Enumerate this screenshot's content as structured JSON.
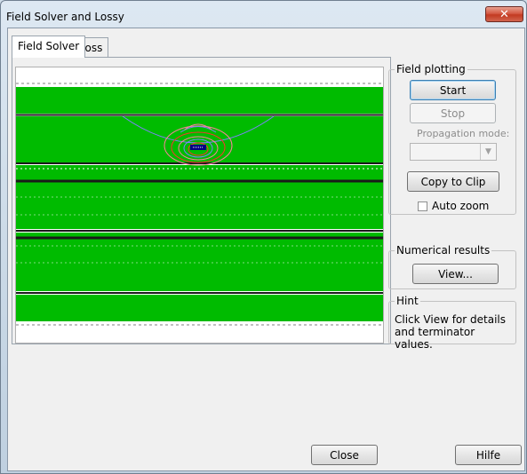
{
  "window": {
    "title": "Field Solver and Lossy",
    "close_glyph": "✕"
  },
  "tabs": [
    {
      "label": "Field Solver",
      "active": true
    },
    {
      "label": "Loss",
      "active": false
    }
  ],
  "field_plotting": {
    "label": "Field plotting",
    "start_label": "Start",
    "stop_label": "Stop",
    "propagation_mode_label": "Propagation mode:",
    "propagation_mode_value": "",
    "copy_label": "Copy to Clip",
    "auto_zoom_label": "Auto zoom",
    "auto_zoom_checked": false
  },
  "numerical_results": {
    "label": "Numerical results",
    "view_label": "View..."
  },
  "hint": {
    "label": "Hint",
    "text": "Click View for details and terminator values."
  },
  "footer": {
    "close_label": "Close",
    "help_label": "Hilfe"
  },
  "plot": {
    "dielectric_color": "#00bb00",
    "conductor_color": "#1a1a1a",
    "trace_color": "#000080",
    "field_colors": [
      "#ff3030",
      "#8080ff",
      "#ff80a0"
    ]
  }
}
